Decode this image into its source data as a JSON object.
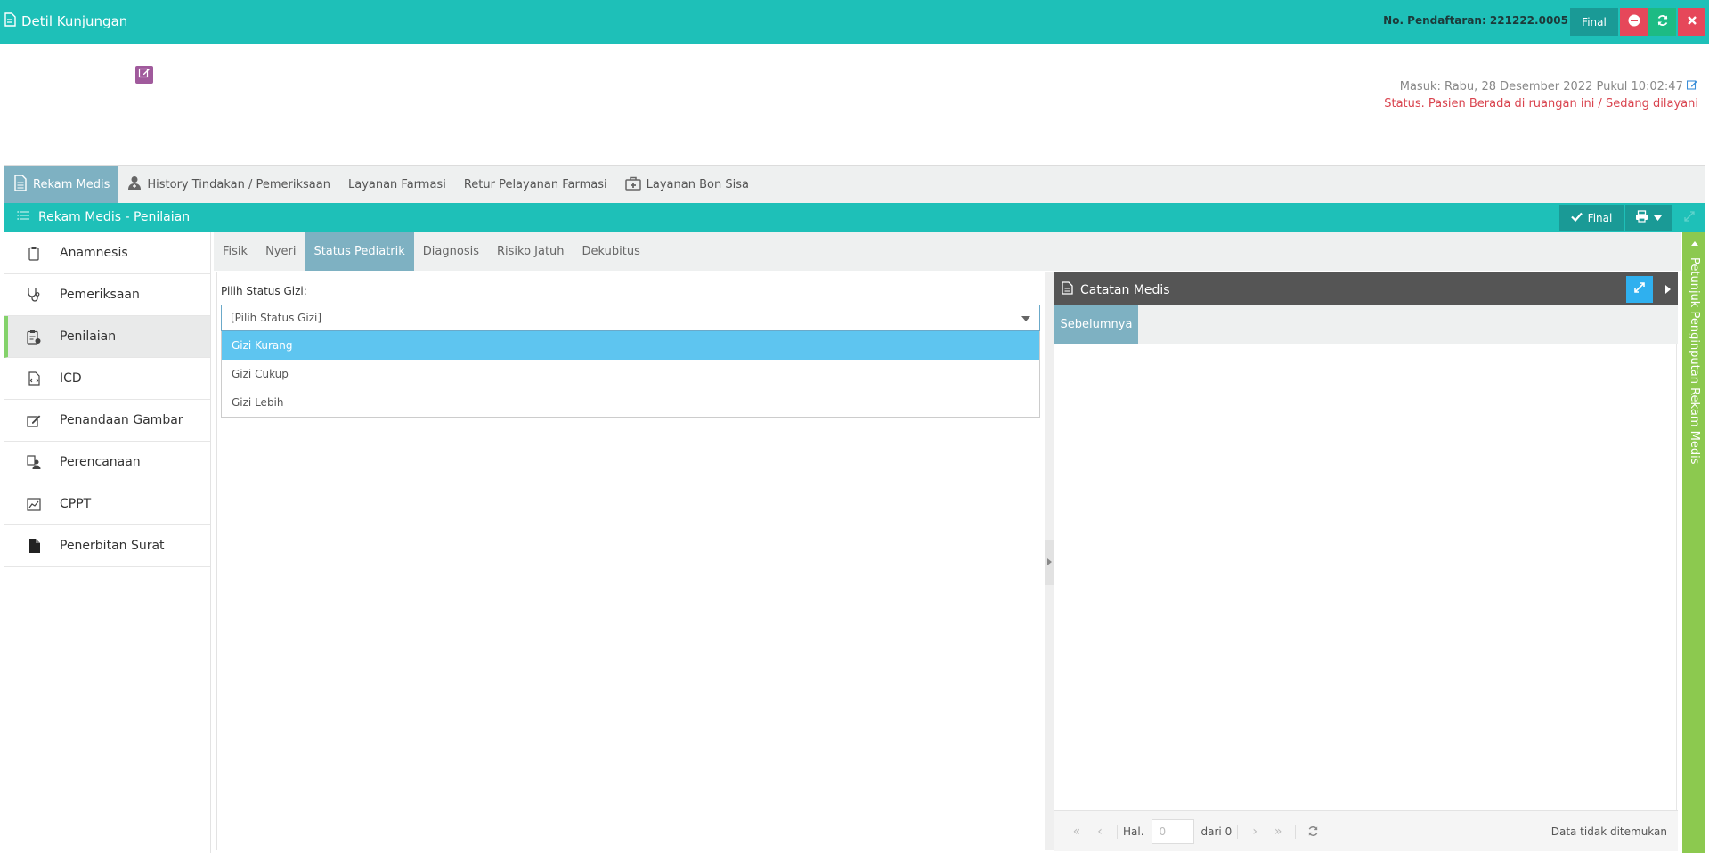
{
  "header": {
    "title": "Detil Kunjungan",
    "no_pendaftaran": "No. Pendaftaran: 221222.0005",
    "final_label": "Final"
  },
  "visit": {
    "masuk": "Masuk: Rabu, 28 Desember 2022 Pukul 10:02:47",
    "status": "Status. Pasien Berada di ruangan ini / Sedang dilayani"
  },
  "main_tabs": [
    {
      "label": "Rekam Medis",
      "icon": "document-icon"
    },
    {
      "label": "History Tindakan / Pemeriksaan",
      "icon": "user-md-icon"
    },
    {
      "label": "Layanan Farmasi",
      "icon": ""
    },
    {
      "label": "Retur Pelayanan Farmasi",
      "icon": ""
    },
    {
      "label": "Layanan Bon Sisa",
      "icon": "medkit-icon"
    }
  ],
  "panel": {
    "title": "Rekam Medis - Penilaian",
    "final_label": "Final"
  },
  "sidebar": {
    "items": [
      {
        "label": "Anamnesis",
        "icon": "clipboard-icon"
      },
      {
        "label": "Pemeriksaan",
        "icon": "stethoscope-icon"
      },
      {
        "label": "Penilaian",
        "icon": "clipboard-check-icon"
      },
      {
        "label": "ICD",
        "icon": "file-code-icon"
      },
      {
        "label": "Penandaan Gambar",
        "icon": "edit-icon"
      },
      {
        "label": "Perencanaan",
        "icon": "user-plan-icon"
      },
      {
        "label": "CPPT",
        "icon": "chart-icon"
      },
      {
        "label": "Penerbitan Surat",
        "icon": "file-icon"
      }
    ],
    "active_index": 2
  },
  "sub_tabs": [
    "Fisik",
    "Nyeri",
    "Status Pediatrik",
    "Diagnosis",
    "Risiko Jatuh",
    "Dekubitus"
  ],
  "form": {
    "label": "Pilih Status Gizi:",
    "select_value": "[Pilih Status Gizi]",
    "options": [
      "Gizi Kurang",
      "Gizi Cukup",
      "Gizi Lebih"
    ],
    "highlighted_option": "Gizi Kurang"
  },
  "catatan": {
    "title": "Catatan Medis",
    "tab": "Sebelumnya",
    "pager": {
      "hal_label": "Hal.",
      "page_value": "0",
      "of_label": "dari 0",
      "empty_text": "Data tidak ditemukan"
    }
  },
  "right_panel": {
    "label": "Petunjuk Penginputan Rekam Medis"
  },
  "colors": {
    "teal": "#1ec0b8",
    "tab_active": "#7eb1c2",
    "danger": "#e6475a",
    "success": "#1dbb84",
    "dropdown_highlight": "#5ec5f0",
    "right_bar": "#8cc94f",
    "status_text": "#d9434e"
  }
}
